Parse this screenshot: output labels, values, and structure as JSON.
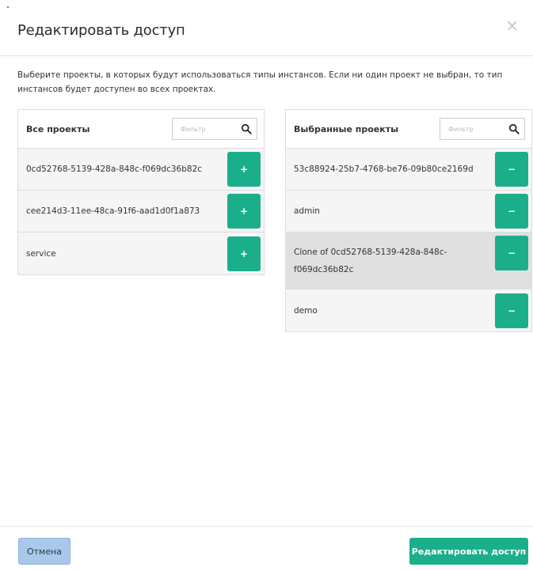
{
  "modal": {
    "title": "Редактировать доступ",
    "close_glyph": "×",
    "description": "Выберите проекты, в которых будут использоваться типы инстансов. Если ни один проект не выбран, то тип инстансов будет доступен во всех проектах."
  },
  "all_projects": {
    "title": "Все проекты",
    "filter_placeholder": "Фильтр",
    "items": [
      {
        "label": "0cd52768-5139-428a-848c-f069dc36b82c",
        "button": "+"
      },
      {
        "label": "cee214d3-11ee-48ca-91f6-aad1d0f1a873",
        "button": "+"
      },
      {
        "label": "service",
        "button": "+"
      }
    ]
  },
  "selected_projects": {
    "title": "Выбранные проекты",
    "filter_placeholder": "Фильтр",
    "items": [
      {
        "label": "53c88924-25b7-4768-be76-09b80ce2169d",
        "button": "−"
      },
      {
        "label": "admin",
        "button": "−"
      },
      {
        "label": "Clone of 0cd52768-5139-428a-848c-f069dc36b82c",
        "button": "−"
      },
      {
        "label": "demo",
        "button": "−"
      }
    ]
  },
  "footer": {
    "cancel_label": "Отмена",
    "submit_label": "Редактировать доступ"
  },
  "colors": {
    "accent": "#1aaf8a",
    "cancel_bg": "#a9c8ea"
  },
  "icons": {
    "search": "search-icon",
    "close": "close-icon"
  }
}
